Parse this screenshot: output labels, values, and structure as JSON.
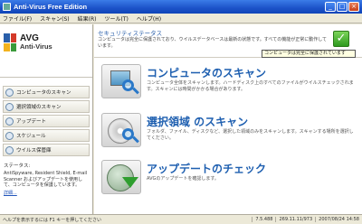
{
  "window": {
    "title": "Anti-Virus Free Edition"
  },
  "menu": [
    "ファイル(F)",
    "スキャン(S)",
    "結果(R)",
    "ツール(T)",
    "ヘルプ(H)"
  ],
  "logo": {
    "brand": "AVG",
    "product": "Anti-Virus"
  },
  "nav": [
    {
      "label": "コンピュータのスキャン",
      "icon": "monitor-icon"
    },
    {
      "label": "選択領域のスキャン",
      "icon": "folder-icon"
    },
    {
      "label": "アップデート",
      "icon": "update-icon"
    },
    {
      "label": "スケジュール",
      "icon": "clock-icon"
    },
    {
      "label": "ウイルス保管庫",
      "icon": "vault-icon"
    }
  ],
  "status_box": {
    "title": "ステータス:",
    "body": "AntiSpyware, Resident Shield, E-mail Scanner およびアップデートを使用して、コンピュータを保護しています。",
    "link": "詳細..."
  },
  "section": {
    "title": "セキュリティステータス",
    "text": "コンピュータは完全に保護されており、ウイルスデータベースは最新の状態です。すべての機能が正常に動作しています。"
  },
  "tooltip": "コンピュータは完全に保護されています",
  "tasks": [
    {
      "title": "コンピュータのスキャン",
      "desc": "コンピュータ全体をスキャンします。ハードディスク上のすべてのファイルがウイルスチェックされます。スキャンには時間がかかる場合があります。"
    },
    {
      "title": "選択領域 のスキャン",
      "desc": "フォルダ、ファイル、ディスクなど、選択した領域のみをスキャンします。スキャンする場所を選択してください。"
    },
    {
      "title": "アップデートのチェック",
      "desc": "AVGのアップデートを確認します。"
    }
  ],
  "statusbar": {
    "left": "ヘルプを表示するには F1 キーを押してください",
    "version": "7.5.488",
    "database": "269.11.11/973",
    "date": "2007/08/24 14:58"
  },
  "colors": {
    "accent": "#1e5fb0",
    "titlebar": "#1c52c8",
    "ok": "#2e9a1e"
  }
}
